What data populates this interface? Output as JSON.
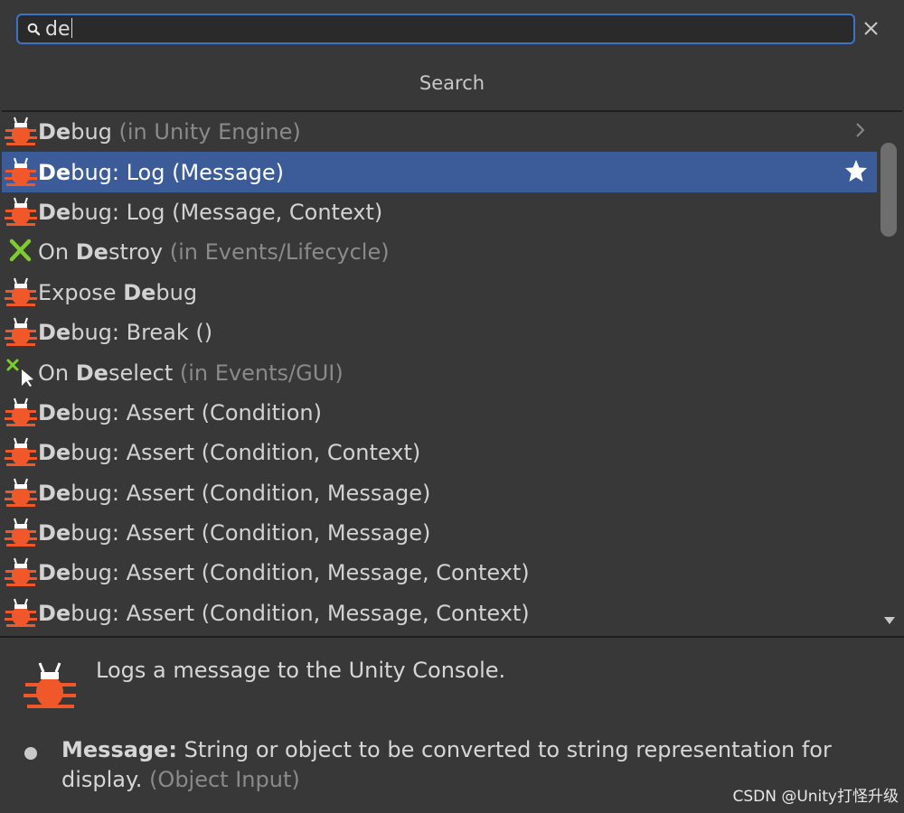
{
  "search": {
    "query": "de",
    "title": "Search"
  },
  "results": [
    {
      "icon": "bug-icon",
      "pre": "",
      "bold": "De",
      "post": "bug",
      "dim": " (in Unity Engine)",
      "chevron": true
    },
    {
      "icon": "bug-icon",
      "pre": "",
      "bold": "De",
      "post": "bug: Log (Message)",
      "dim": "",
      "selected": true,
      "favorite": true
    },
    {
      "icon": "bug-icon",
      "pre": "",
      "bold": "De",
      "post": "bug: Log (Message, Context)",
      "dim": ""
    },
    {
      "icon": "destroy-x-icon",
      "pre": "On ",
      "bold": "De",
      "post": "stroy ",
      "dim": " (in Events/Lifecycle)"
    },
    {
      "icon": "bug-icon",
      "pre": "Expose ",
      "bold": "De",
      "post": "bug",
      "dim": ""
    },
    {
      "icon": "bug-icon",
      "pre": "",
      "bold": "De",
      "post": "bug: Break ()",
      "dim": ""
    },
    {
      "icon": "deselect-cursor-icon",
      "pre": "On ",
      "bold": "De",
      "post": "select ",
      "dim": " (in Events/GUI)"
    },
    {
      "icon": "bug-icon",
      "pre": "",
      "bold": "De",
      "post": "bug: Assert (Condition)",
      "dim": ""
    },
    {
      "icon": "bug-icon",
      "pre": "",
      "bold": "De",
      "post": "bug: Assert (Condition, Context)",
      "dim": ""
    },
    {
      "icon": "bug-icon",
      "pre": "",
      "bold": "De",
      "post": "bug: Assert (Condition, Message)",
      "dim": ""
    },
    {
      "icon": "bug-icon",
      "pre": "",
      "bold": "De",
      "post": "bug: Assert (Condition, Message)",
      "dim": ""
    },
    {
      "icon": "bug-icon",
      "pre": "",
      "bold": "De",
      "post": "bug: Assert (Condition, Message, Context)",
      "dim": ""
    },
    {
      "icon": "bug-icon",
      "pre": "",
      "bold": "De",
      "post": "bug: Assert (Condition, Message, Context)",
      "dim": ""
    }
  ],
  "detail": {
    "description": "Logs a message to the Unity Console.",
    "param_name": "Message:",
    "param_desc": " String or object to be converted to string representation for display.",
    "param_type": " (Object Input)"
  },
  "watermark": "CSDN @Unity打怪升级",
  "colors": {
    "accent": "#3b74c6",
    "selected_row": "#3b5c98",
    "bug": "#f0582a",
    "destroy": "#7ccf2a"
  }
}
